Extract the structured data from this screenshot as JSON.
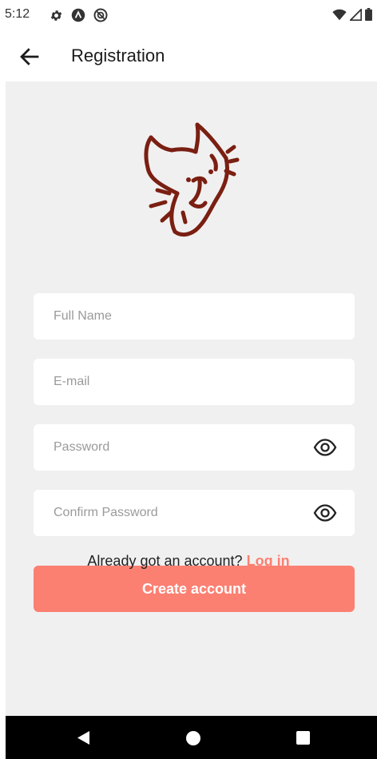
{
  "status_bar": {
    "time": "5:12",
    "left_icons": [
      "settings-icon",
      "notification-a-icon",
      "notification-b-icon"
    ],
    "right_icons": [
      "wifi-icon",
      "signal-icon",
      "battery-icon"
    ]
  },
  "app_bar": {
    "title": "Registration",
    "back_icon": "arrow-left-icon"
  },
  "form": {
    "full_name": {
      "placeholder": "Full Name",
      "value": ""
    },
    "email": {
      "placeholder": "E-mail",
      "value": ""
    },
    "password": {
      "placeholder": "Password",
      "value": ""
    },
    "confirm_password": {
      "placeholder": "Confirm Password",
      "value": ""
    },
    "create_button": "Create account"
  },
  "login_prompt": {
    "text": "Already got an account?",
    "link": "Log in"
  },
  "colors": {
    "accent": "#fb8072",
    "logo": "#7a1f12",
    "background": "#f1f0f0"
  }
}
